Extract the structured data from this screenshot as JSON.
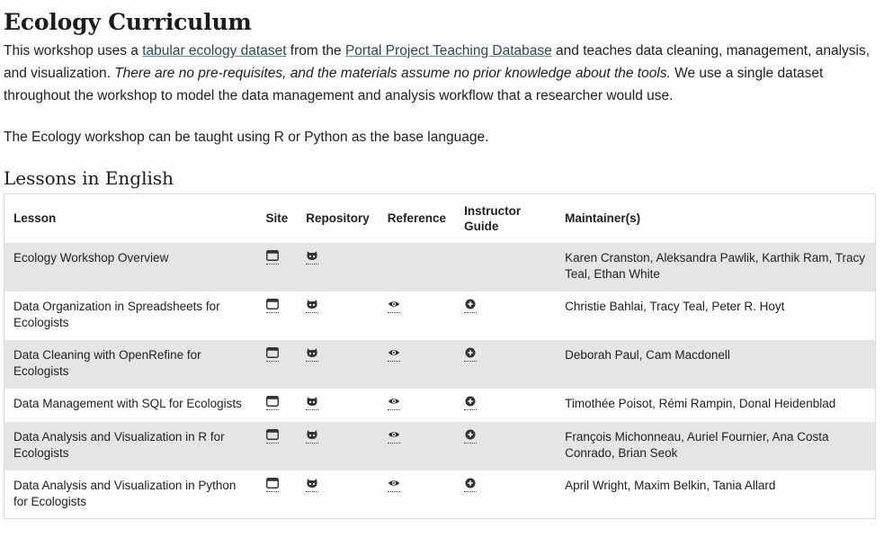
{
  "page": {
    "title": "Ecology Curriculum",
    "intro": {
      "part1": "This workshop uses a ",
      "link1": "tabular ecology dataset",
      "part2": " from the ",
      "link2": "Portal Project Teaching Database",
      "part3": " and teaches data cleaning, management, analysis, and visualization. ",
      "italic": "There are no pre-requisites, and the materials assume no prior knowledge about the tools.",
      "part4": " We use a single dataset throughout the workshop to model the data management and analysis workflow that a researcher would use."
    },
    "note": "The Ecology workshop can be taught using R or Python as the base language.",
    "section_title": "Lessons in English"
  },
  "table": {
    "headers": {
      "lesson": "Lesson",
      "site": "Site",
      "repository": "Repository",
      "reference": "Reference",
      "instructor_guide": "Instructor Guide",
      "maintainers": "Maintainer(s)"
    },
    "rows": [
      {
        "lesson": "Ecology Workshop Overview",
        "has_reference": false,
        "has_guide": false,
        "maintainers": "Karen Cranston, Aleksandra Pawlik, Karthik Ram, Tracy Teal, Ethan White"
      },
      {
        "lesson": "Data Organization in Spreadsheets for Ecologists",
        "has_reference": true,
        "has_guide": true,
        "maintainers": "Christie Bahlai, Tracy Teal, Peter R. Hoyt"
      },
      {
        "lesson": "Data Cleaning with OpenRefine for Ecologists",
        "has_reference": true,
        "has_guide": true,
        "maintainers": "Deborah Paul, Cam Macdonell"
      },
      {
        "lesson": "Data Management with SQL for Ecologists",
        "has_reference": true,
        "has_guide": true,
        "maintainers": "Timothée Poisot, Rémi Rampin, Donal Heidenblad"
      },
      {
        "lesson": "Data Analysis and Visualization in R for Ecologists",
        "has_reference": true,
        "has_guide": true,
        "maintainers": "François Michonneau, Auriel Fournier, Ana Costa Conrado, Brian Seok"
      },
      {
        "lesson": "Data Analysis and Visualization in Python for Ecologists",
        "has_reference": true,
        "has_guide": true,
        "maintainers": "April Wright, Maxim Belkin, Tania Allard"
      }
    ]
  },
  "icons": {
    "site": "browser-window-icon",
    "repository": "github-octocat-icon",
    "reference": "eye-icon",
    "guide": "plus-circle-icon"
  }
}
